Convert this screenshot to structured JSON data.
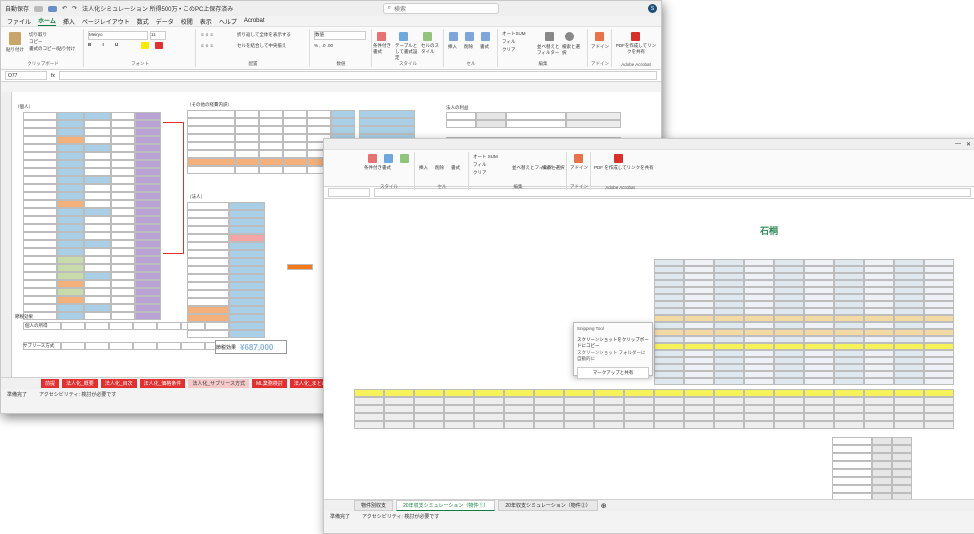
{
  "colors": {
    "excel_green": "#107c41",
    "accent_red": "#e03030",
    "purple": "#b9a3d6",
    "blue": "#a9cfe6",
    "orange": "#f3b07a",
    "green": "#c8dcab",
    "yellow": "#f6f35a"
  },
  "window1": {
    "autosave_label": "自動保存",
    "title": "法人化シミュレーション 所得500万 • このPC上保存済み",
    "search_placeholder": "検索",
    "avatar_initial": "S",
    "menu": [
      "ファイル",
      "ホーム",
      "挿入",
      "ページレイアウト",
      "数式",
      "データ",
      "校閲",
      "表示",
      "ヘルプ",
      "Acrobat"
    ],
    "ribbon": {
      "paste": "貼り付け",
      "cut": "切り取り",
      "copy": "コピー",
      "format_painter": "書式のコピー/貼り付け",
      "clipboard": "クリップボード",
      "font_name": "Meiryo",
      "font_size": "11",
      "font": "フォント",
      "wrap": "折り返して全体を表示する",
      "merge": "セルを結合して中央揃え",
      "alignment": "配置",
      "number_format": "数値",
      "number": "数値",
      "cond_format": "条件付き書式",
      "table_format": "テーブルとして書式設定",
      "cell_style": "セルのスタイル",
      "styles": "スタイル",
      "insert": "挿入",
      "delete": "削除",
      "format": "書式",
      "cells": "セル",
      "autosum": "オートSUM",
      "fill": "フィル",
      "clear": "クリア",
      "sort": "並べ替えとフィルター",
      "find": "検索と選択",
      "editing": "編集",
      "addin": "アドイン",
      "addin_group": "アドイン",
      "pdf": "PDFを作成してリンクを共有",
      "acrobat": "Adobe Acrobat"
    },
    "name_box": "O77",
    "sheet_labels": {
      "s1": "（個人）",
      "s2": "（その他の経費内訳）",
      "s3": "（法人）",
      "s4": "節税効果",
      "s5": "個人の所得",
      "s6": "サブリース方式",
      "s7": "節税効果",
      "s8": "法人の利益"
    },
    "savings_value": "¥687,000",
    "tabs": [
      "前提",
      "法人化_概要",
      "法人化_目次",
      "法人化_価格条件",
      "法人化_サブリース方式",
      "ML業務検討",
      "法人化_まとめ"
    ],
    "status_ready": "準備完了",
    "status_access": "アクセシビリティ: 検討が必要です"
  },
  "window2": {
    "menu": [
      "ファイル",
      "ホーム",
      "挿入",
      "ページレイアウト",
      "数式",
      "データ",
      "校閲",
      "表示",
      "ヘルプ",
      "Acrobat"
    ],
    "ribbon": {
      "cond_format": "条件付き書式",
      "table_format": "テーブルとして書式設定",
      "cell_style": "セルのスタイル",
      "insert": "挿入",
      "delete": "削除",
      "format": "書式",
      "autosum": "オート SUM",
      "fill": "フィル",
      "clear": "クリア",
      "sort": "並べ替えとフィルター",
      "find": "検索と選択",
      "addin": "アドイン",
      "pdf": "PDF を作成してリンクを共有",
      "styles": "スタイル",
      "cells": "セル",
      "editing": "編集",
      "addin_group": "アドイン",
      "acrobat": "Adobe Acrobat"
    },
    "logo_text": "石桐",
    "tabs": [
      "物件別収支",
      "20年収支シミュレーション（物件①）",
      "20年収支シミュレーション（物件②）"
    ],
    "status_ready": "準備完了",
    "status_access": "アクセシビリティ: 検討が必要です",
    "toast": {
      "app": "Snipping Tool",
      "line1": "スクリーンショットをクリップボードにコピー",
      "line2": "スクリーンショット フォルダーに自動的に",
      "action": "マークアップと共有"
    }
  }
}
